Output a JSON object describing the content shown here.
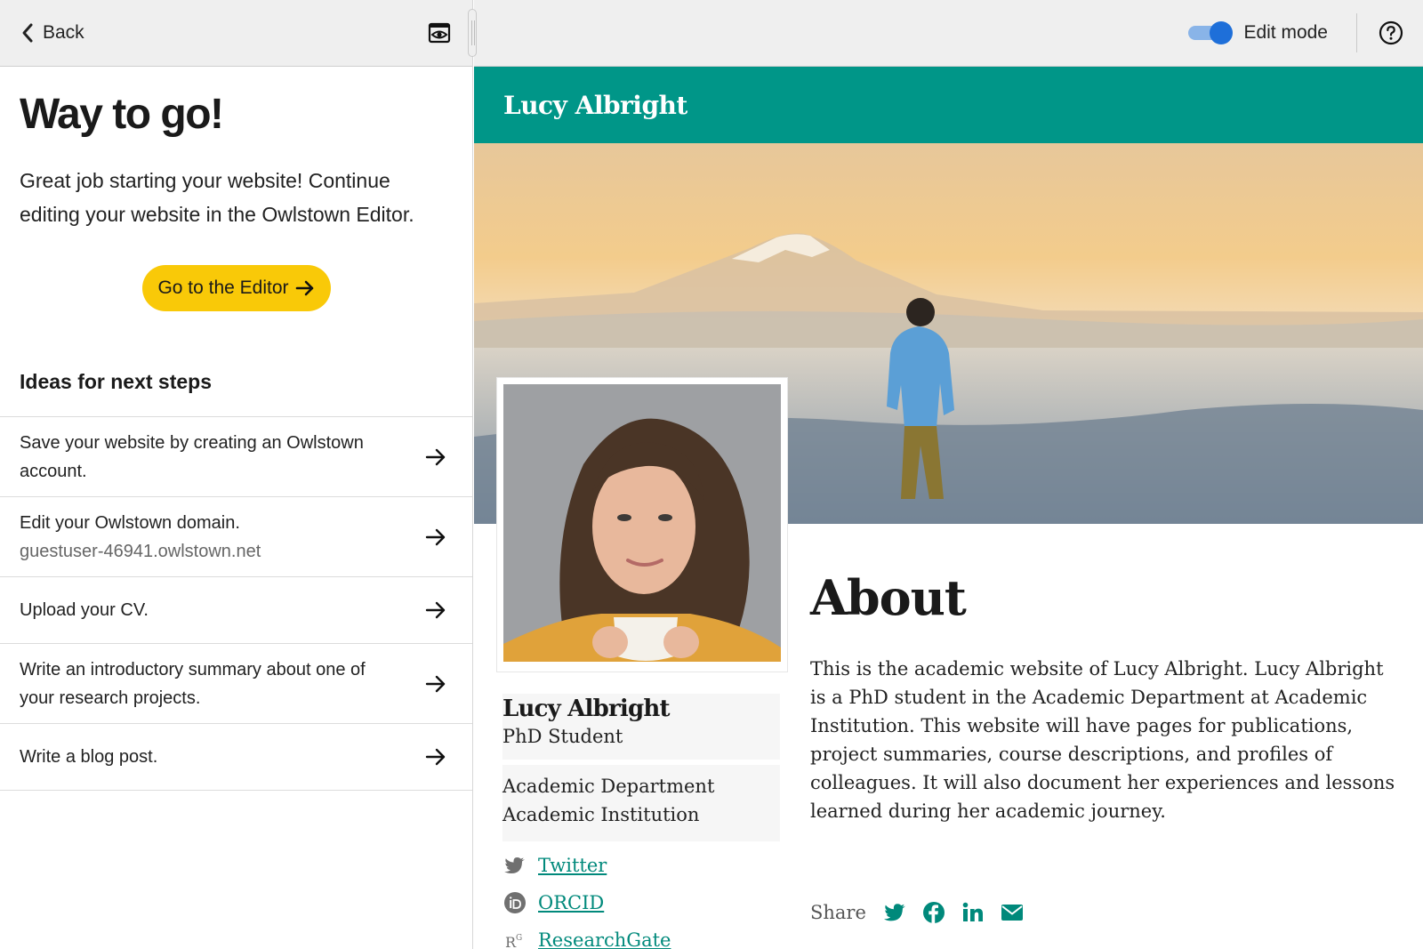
{
  "editor": {
    "back_label": "Back",
    "heading": "Way to go!",
    "intro": "Great job starting your website! Continue editing your website in the Owlstown Editor.",
    "editor_button": "Go to the Editor",
    "ideas_heading": "Ideas for next steps",
    "steps": [
      {
        "text": "Save your website by creating an Owlstown account.",
        "sub": ""
      },
      {
        "text": "Edit your Owlstown domain.",
        "sub": "guestuser-46941.owlstown.net"
      },
      {
        "text": "Upload your CV.",
        "sub": ""
      },
      {
        "text": "Write an introductory summary about one of your research projects.",
        "sub": ""
      },
      {
        "text": "Write a blog post.",
        "sub": ""
      }
    ]
  },
  "toolbar": {
    "edit_mode_label": "Edit mode",
    "edit_mode_on": true
  },
  "site": {
    "title": "Lucy Albright",
    "accent": "#009688",
    "profile": {
      "name": "Lucy Albright",
      "title": "PhD Student",
      "department": "Academic Department",
      "institution": "Academic Institution",
      "links": [
        {
          "icon": "twitter-icon",
          "label": "Twitter"
        },
        {
          "icon": "orcid-icon",
          "label": "ORCID"
        },
        {
          "icon": "researchgate-icon",
          "label": "ResearchGate"
        }
      ]
    },
    "about": {
      "heading": "About",
      "text": "This is the academic website of Lucy Albright. Lucy Albright is a PhD student in the Academic Department at Academic Institution. This website will have pages for publications, project summaries, course descriptions, and profiles of colleagues. It will also document her experiences and lessons learned during her academic journey."
    },
    "share_label": "Share"
  }
}
